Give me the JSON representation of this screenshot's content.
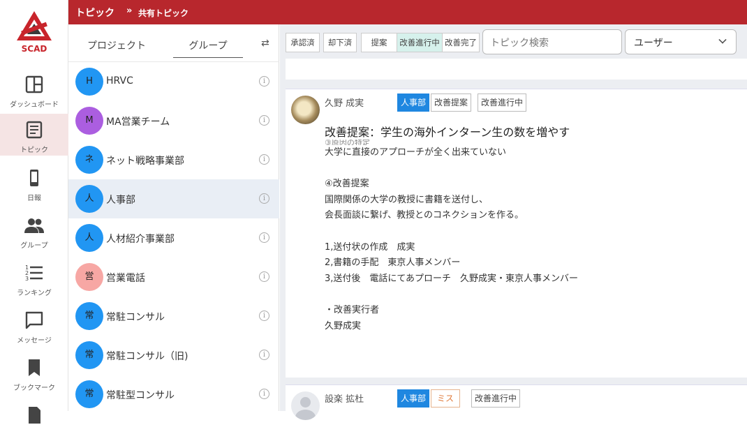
{
  "brand": {
    "name": "SCAD",
    "color": "#c8242b"
  },
  "nav": [
    {
      "label": "ダッシュボード",
      "icon": "dashboard-icon"
    },
    {
      "label": "トピック",
      "icon": "topic-icon",
      "active": true
    },
    {
      "label": "日報",
      "icon": "phone-icon"
    },
    {
      "label": "グループ",
      "icon": "group-icon"
    },
    {
      "label": "ランキング",
      "icon": "ranking-icon"
    },
    {
      "label": "メッセージ",
      "icon": "message-icon"
    },
    {
      "label": "ブックマーク",
      "icon": "bookmark-icon"
    }
  ],
  "header": {
    "title": "トピック",
    "breadcrumb": "共有トピック"
  },
  "panel": {
    "tabs": {
      "project": "プロジェクト",
      "group": "グループ"
    },
    "groups": [
      {
        "initial": "H",
        "name": "HRVC",
        "color": "#2196f3"
      },
      {
        "initial": "M",
        "name": "MA営業チーム",
        "color": "#ab5ee0"
      },
      {
        "initial": "ネ",
        "name": "ネット戦略事業部",
        "color": "#2196f3"
      },
      {
        "initial": "人",
        "name": "人事部",
        "color": "#2196f3",
        "active": true
      },
      {
        "initial": "人",
        "name": "人材紹介事業部",
        "color": "#2196f3"
      },
      {
        "initial": "営",
        "name": "営業電話",
        "color": "#f7a7a4"
      },
      {
        "initial": "常",
        "name": "常駐コンサル",
        "color": "#2196f3"
      },
      {
        "initial": "常",
        "name": "常駐コンサル（旧)",
        "color": "#2196f3"
      },
      {
        "initial": "常",
        "name": "常駐型コンサル",
        "color": "#2196f3"
      }
    ]
  },
  "filters": {
    "approved": "承認済",
    "rejected": "却下済",
    "proposal": "提案",
    "in_progress": "改善進行中",
    "done": "改善完了"
  },
  "search": {
    "placeholder": "トピック検索"
  },
  "user_select": {
    "value": "ユーザー"
  },
  "posts": [
    {
      "author": "久野 成実",
      "dept": "人事部",
      "category": "改善提案",
      "status": "改善進行中",
      "title": "改善提案：学生の海外インターン生の数を増やす",
      "cut_line": "③原因の特定",
      "lines": [
        "大学に直接のアプローチが全く出来ていない",
        "",
        "④改善提案",
        "国際関係の大学の教授に書籍を送付し、",
        "会長面談に繋げ、教授とのコネクションを作る。",
        "",
        "1,送付状の作成　成実",
        "2,書籍の手配　東京人事メンバー",
        "3,送付後　電話にてあプローチ　久野成実・東京人事メンバー",
        "",
        "・改善実行者",
        "久野成実"
      ]
    },
    {
      "author": "設楽 拡杜",
      "dept": "人事部",
      "category": "ミス",
      "status": "改善進行中"
    }
  ]
}
